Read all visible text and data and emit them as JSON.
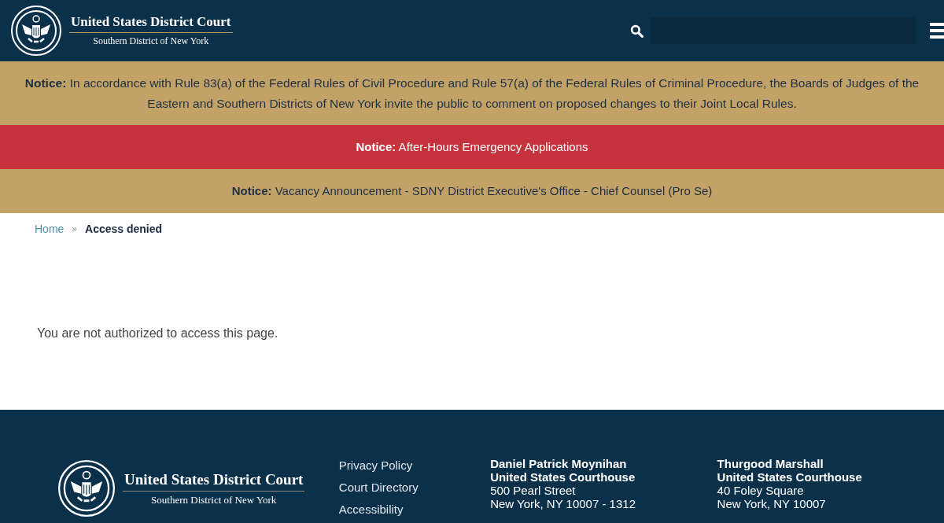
{
  "header": {
    "title": "United States District Court",
    "subtitle": "Southern District of New York"
  },
  "notices": [
    {
      "label": "Notice:",
      "text": "In accordance with Rule 83(a) of the Federal Rules of Civil Procedure and Rule 57(a) of the Federal Rules of Criminal Procedure, the Boards of Judges of the Eastern and Southern Districts of New York invite the public to comment on proposed changes to their Joint Local Rules.",
      "kind": "info"
    },
    {
      "label": "Notice:",
      "text": "After-Hours Emergency Applications",
      "kind": "alert"
    },
    {
      "label": "Notice:",
      "text": "Vacancy Announcement  - SDNY District Executive's Office - Chief Counsel (Pro Se)",
      "kind": "info"
    }
  ],
  "breadcrumb": [
    {
      "label": "Home",
      "selected": false
    },
    {
      "label": "»",
      "kind": "separator"
    },
    {
      "label": "Access denied",
      "selected": true
    }
  ],
  "message": "You are not authorized to access this page.",
  "footer": {
    "title": "United States District Court",
    "subtitle": "Southern District of New York",
    "links": [
      "Privacy Policy",
      "Court Directory",
      "Accessibility"
    ],
    "addresses": [
      {
        "name": [
          "Daniel Patrick Moynihan",
          "United States Courthouse"
        ],
        "lines": [
          "500 Pearl Street",
          "New York, NY 10007 - 1312"
        ]
      },
      {
        "name": [
          "Thurgood Marshall",
          "United States Courthouse"
        ],
        "lines": [
          "40 Foley Square",
          "New York, NY 10007"
        ]
      }
    ]
  }
}
